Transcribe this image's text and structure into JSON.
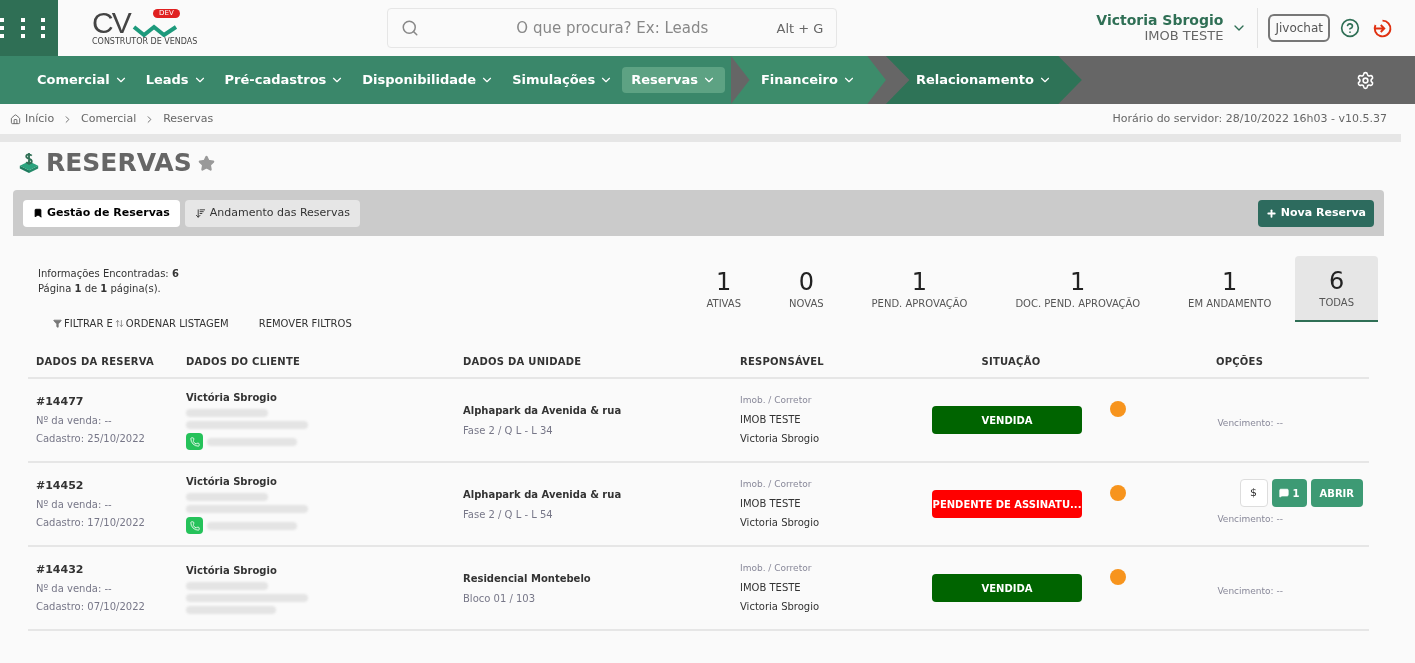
{
  "header": {
    "logo": {
      "letters": "CV",
      "badge": "DEV",
      "tagline": "CONSTRUTOR DE VENDAS"
    },
    "search": {
      "placeholder": "O que procura? Ex: Leads",
      "shortcut": "Alt + G"
    },
    "user": {
      "name": "Victoria Sbrogio",
      "company": "IMOB TESTE"
    },
    "chat_button": "Jivochat"
  },
  "nav": [
    {
      "label": "Comercial",
      "selected": false,
      "kind": "plain"
    },
    {
      "label": "Leads",
      "selected": false,
      "kind": "plain"
    },
    {
      "label": "Pré-cadastros",
      "selected": false,
      "kind": "plain"
    },
    {
      "label": "Disponibilidade",
      "selected": false,
      "kind": "plain"
    },
    {
      "label": "Simulações",
      "selected": false,
      "kind": "plain"
    },
    {
      "label": "Reservas",
      "selected": true,
      "kind": "plain"
    },
    {
      "label": "Financeiro",
      "selected": false,
      "kind": "segment-light"
    },
    {
      "label": "Relacionamento",
      "selected": false,
      "kind": "segment-dark"
    }
  ],
  "breadcrumb": [
    "Início",
    "Comercial",
    "Reservas"
  ],
  "server_time": "Horário do servidor: 28/10/2022 16h03 - v10.5.37",
  "page_title": "RESERVAS",
  "tabs": [
    {
      "label": "Gestão de Reservas",
      "selected": true
    },
    {
      "label": "Andamento das Reservas",
      "selected": false
    }
  ],
  "new_button": "Nova Reserva",
  "info": {
    "found": "Informações Encontradas: **6**",
    "page": "Página **1** de **1** página(s)."
  },
  "filters": {
    "filter_label": "FILTRAR E",
    "order_label": "ORDENAR LISTAGEM",
    "remove": "REMOVER FILTROS"
  },
  "stats": [
    {
      "value": "1",
      "label": "ATIVAS",
      "selected": false
    },
    {
      "value": "0",
      "label": "NOVAS",
      "selected": false
    },
    {
      "value": "1",
      "label": "PEND. APROVAÇÃO",
      "selected": false
    },
    {
      "value": "1",
      "label": "DOC. PEND. APROVAÇÃO",
      "selected": false
    },
    {
      "value": "1",
      "label": "EM ANDAMENTO",
      "selected": false
    },
    {
      "value": "6",
      "label": "TODAS",
      "selected": true
    }
  ],
  "table": {
    "columns": [
      "DADOS DA RESERVA",
      "DADOS DO CLIENTE",
      "DADOS DA UNIDADE",
      "RESPONSÁVEL",
      "SITUAÇÃO",
      "OPÇÕES"
    ],
    "rows": [
      {
        "id": "#14477",
        "sale": "Nº da venda: --",
        "created": "Cadastro: 25/10/2022",
        "client": "Victória Sbrogio",
        "whatsapp": true,
        "unit": "Alphapark da Avenida & rua",
        "unit_detail": "Fase 2 / Q L - L 34",
        "resp_label": "Imob. / Corretor",
        "resp_company": "IMOB TESTE",
        "resp_person": "Victoria Sbrogio",
        "status": {
          "label": "VENDIDA",
          "color": "#006400"
        },
        "dot": {
          "color": "#f7941d"
        },
        "actions": [],
        "due": "Vencimento: --"
      },
      {
        "id": "#14452",
        "sale": "Nº da venda: --",
        "created": "Cadastro: 17/10/2022",
        "client": "Victória Sbrogio",
        "whatsapp": true,
        "unit": "Alphapark da Avenida & rua",
        "unit_detail": "Fase 2 / Q L - L 54",
        "resp_label": "Imob. / Corretor",
        "resp_company": "IMOB TESTE",
        "resp_person": "Victoria Sbrogio",
        "status": {
          "label": "PENDENTE DE ASSINATU...",
          "color": "#ff0000"
        },
        "dot": {
          "color": "#f7941d"
        },
        "actions": [
          {
            "kind": "money",
            "label": "$"
          },
          {
            "kind": "comments",
            "label": "1"
          },
          {
            "kind": "open",
            "label": "ABRIR"
          }
        ],
        "due": "Vencimento: --"
      },
      {
        "id": "#14432",
        "sale": "Nº da venda: --",
        "created": "Cadastro: 07/10/2022",
        "client": "Victória Sbrogio",
        "whatsapp": false,
        "unit": "Residencial Montebelo",
        "unit_detail": "Bloco 01 / 103",
        "resp_label": "Imob. / Corretor",
        "resp_company": "IMOB TESTE",
        "resp_person": "Victoria Sbrogio",
        "status": {
          "label": "VENDIDA",
          "color": "#006400"
        },
        "dot": {
          "color": "#f7941d"
        },
        "actions": [],
        "due": "Vencimento: --"
      }
    ]
  }
}
